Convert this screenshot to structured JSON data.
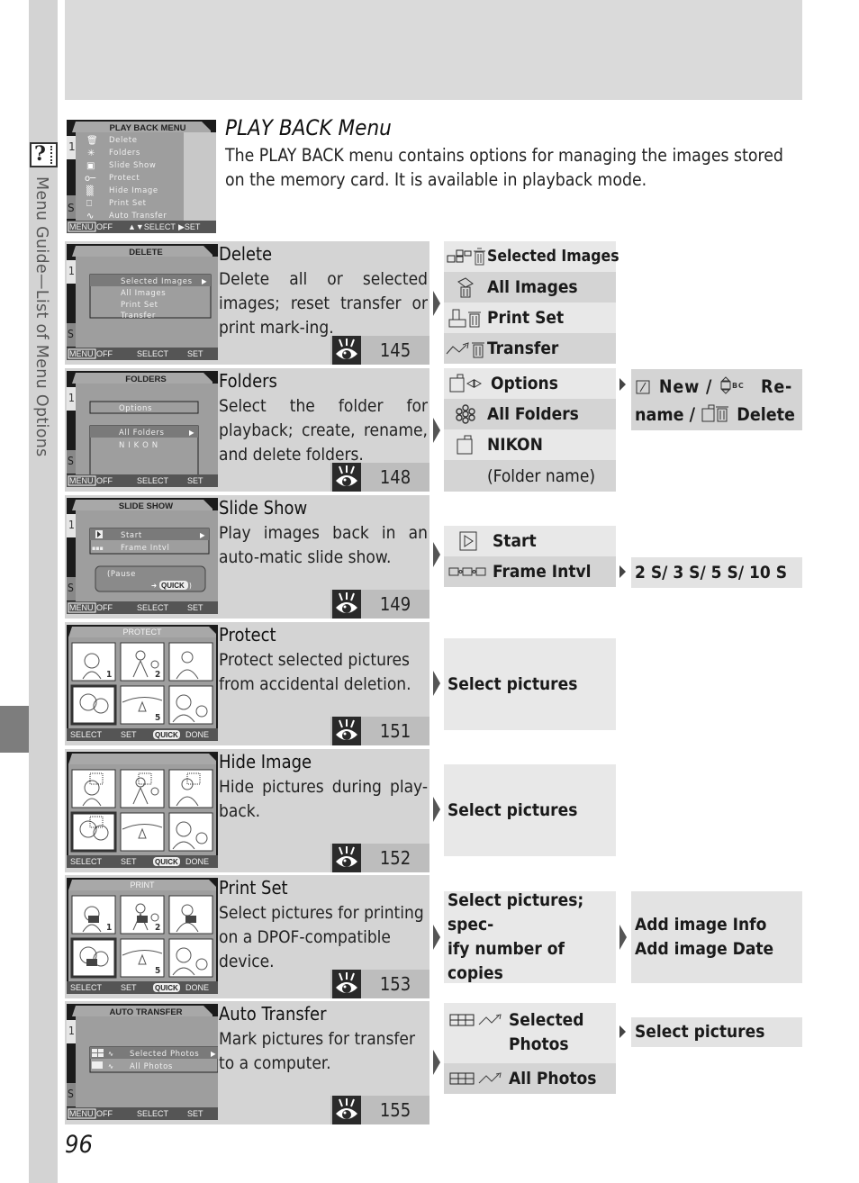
{
  "side_tab": {
    "help_icon": "help-icon",
    "title": "Menu Guide—List of Menu Options"
  },
  "intro": {
    "title": "PLAY BACK Menu",
    "text": "The PLAY BACK menu contains options for managing the images stored on the memory card.  It is available in playback mode.",
    "lcd": {
      "header": "PLAY BACK MENU",
      "tab_top": "1",
      "tab_bottom": "S",
      "items": [
        "Delete",
        "Folders",
        "Slide Show",
        "Protect",
        "Hide Image",
        "Print Set",
        "Auto Transfer"
      ],
      "footer": [
        "MENU",
        "OFF",
        "▲▼SELECT",
        "▶SET"
      ]
    }
  },
  "rows": [
    {
      "title": "Delete",
      "desc": "Delete all or selected images; reset transfer or print mark-ing.",
      "page": "145",
      "lcd": {
        "header": "DELETE",
        "items": [
          "Selected Images",
          "All Images",
          "Print Set",
          "Transfer"
        ],
        "footer": [
          "MENU",
          "OFF",
          "SELECT",
          "SET"
        ]
      },
      "options": [
        {
          "icon": "grid-trash-icon",
          "label": "Selected Images"
        },
        {
          "icon": "all-trash-icon",
          "label": "All Images"
        },
        {
          "icon": "print-trash-icon",
          "label": "Print Set"
        },
        {
          "icon": "transfer-trash-icon",
          "label": "Transfer"
        }
      ]
    },
    {
      "title": "Folders",
      "desc": "Select the folder for playback; create, rename, and delete folders.",
      "page": "148",
      "lcd": {
        "header": "FOLDERS",
        "items": [
          "Options",
          "All Folders",
          "N I K O N"
        ],
        "footer": [
          "MENU",
          "OFF",
          "SELECT",
          "SET"
        ]
      },
      "options": [
        {
          "icon": "folder-options-icon",
          "label": "Options"
        },
        {
          "icon": "all-folders-icon",
          "label": "All Folders"
        },
        {
          "icon": "folder-icon",
          "label": "NIKON"
        },
        {
          "icon": "",
          "label": "(Folder name)"
        }
      ],
      "sub": {
        "line1": "New /",
        "line1b": "Re-",
        "line2": "name /",
        "line2b": "Delete"
      }
    },
    {
      "title": "Slide Show",
      "desc": "Play images back in an auto-matic slide show.",
      "page": "149",
      "lcd": {
        "header": "SLIDE SHOW",
        "items": [
          "Start",
          "Frame Intvl"
        ],
        "pause": "(Pause",
        "quick": "QUICK",
        "footer": [
          "MENU",
          "OFF",
          "SELECT",
          "SET"
        ]
      },
      "options": [
        {
          "icon": "play-icon",
          "label": "Start"
        },
        {
          "icon": "frame-interval-icon",
          "label": "Frame Intvl"
        }
      ],
      "sub": "2 S/ 3 S/ 5 S/ 10 S"
    },
    {
      "title": "Protect",
      "desc": "Protect selected pictures from accidental deletion.",
      "page": "151",
      "lcd": {
        "header": "PROTECT",
        "footer": [
          "SELECT",
          "SET",
          "QUICK",
          "DONE"
        ]
      },
      "box": "Select pictures"
    },
    {
      "title": "Hide Image",
      "desc": "Hide pictures during play-back.",
      "page": "152",
      "lcd": {
        "header": "",
        "footer": [
          "SELECT",
          "SET",
          "QUICK",
          "DONE"
        ]
      },
      "box": "Select pictures"
    },
    {
      "title": "Print Set",
      "desc": "Select pictures for printing on a DPOF-compatible device.",
      "page": "153",
      "lcd": {
        "header": "PRINT",
        "footer": [
          "SELECT",
          "SET",
          "QUICK",
          "DONE"
        ]
      },
      "box_lines": [
        "Select pictures; spec-",
        "ify number of copies"
      ],
      "sub_lines": [
        "Add image Info",
        "Add image Date"
      ]
    },
    {
      "title": "Auto Transfer",
      "desc": "Mark pictures for transfer to a computer.",
      "page": "155",
      "lcd": {
        "header": "AUTO TRANSFER",
        "items": [
          "Selected Photos",
          "All Photos"
        ],
        "footer": [
          "MENU",
          "OFF",
          "SELECT",
          "SET"
        ]
      },
      "options": [
        {
          "icon": "grid-transfer-icon",
          "label_lines": [
            "Selected",
            "Photos"
          ]
        },
        {
          "icon": "all-transfer-icon",
          "label": "All Photos"
        }
      ],
      "sub": "Select pictures"
    }
  ],
  "page_number": "96",
  "colors": {
    "panel": "#d4d4d4",
    "light_cell": "#e8e8e8",
    "lcd_dark": "#1b1b1b",
    "side_strip": "#d3d3d3",
    "side_accent": "#7d7d7d"
  }
}
